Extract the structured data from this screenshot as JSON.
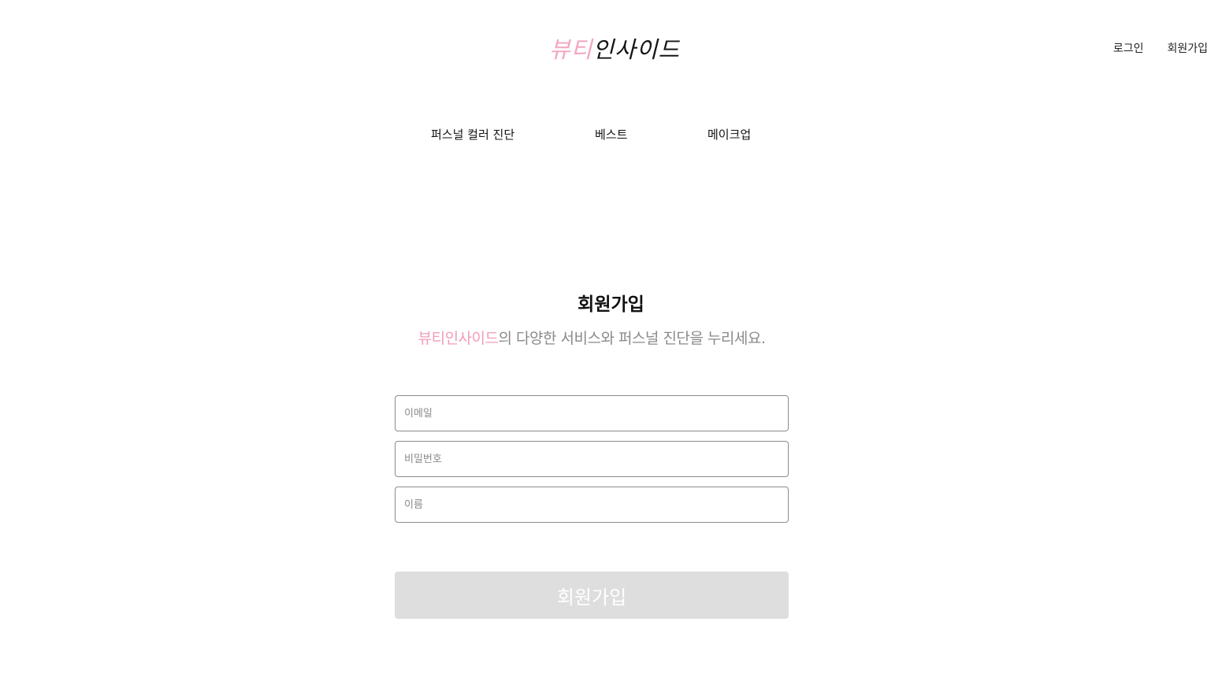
{
  "header": {
    "logo_pink": "뷰티",
    "logo_dark": "인사이드",
    "login_label": "로그인",
    "signup_label": "회원가입"
  },
  "nav": {
    "items": [
      "퍼스널 컬러 진단",
      "베스트",
      "메이크업"
    ]
  },
  "signup": {
    "title": "회원가입",
    "subtitle_brand": "뷰티인사이드",
    "subtitle_rest": "의 다양한 서비스와 퍼스널 진단을 누리세요.",
    "email_placeholder": "이메일",
    "password_placeholder": "비밀번호",
    "name_placeholder": "이름",
    "submit_label": "회원가입"
  },
  "colors": {
    "accent_pink": "#f4a6bf",
    "button_disabled": "#dedede",
    "subtitle_gray": "#8a8a8a"
  }
}
